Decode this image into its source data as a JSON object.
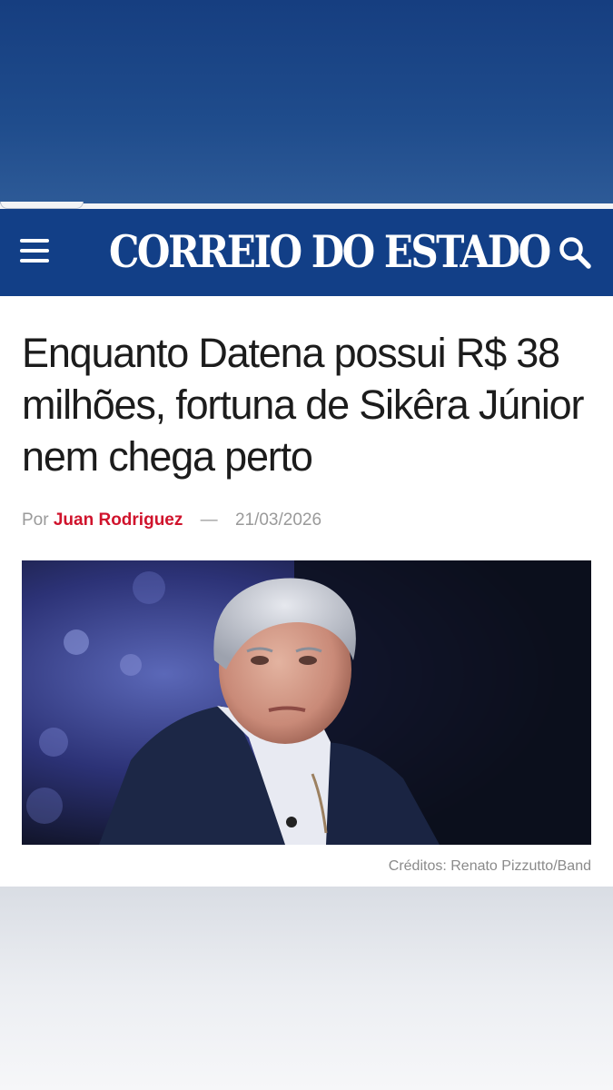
{
  "header": {
    "logo_text": "CORREIO DO ESTADO",
    "menu_icon": "hamburger-menu-icon",
    "search_icon": "search-icon",
    "background_color": "#123f87"
  },
  "article": {
    "title": "Enquanto Datena possui R$ 38 milhões, fortuna de Sikêra Júnior nem chega perto",
    "byline_prefix": "Por",
    "author": "Juan Rodriguez",
    "separator": "—",
    "date": "21/03/2026",
    "image_caption": "Créditos: Renato Pizzutto/Band",
    "author_color": "#d0132c"
  }
}
